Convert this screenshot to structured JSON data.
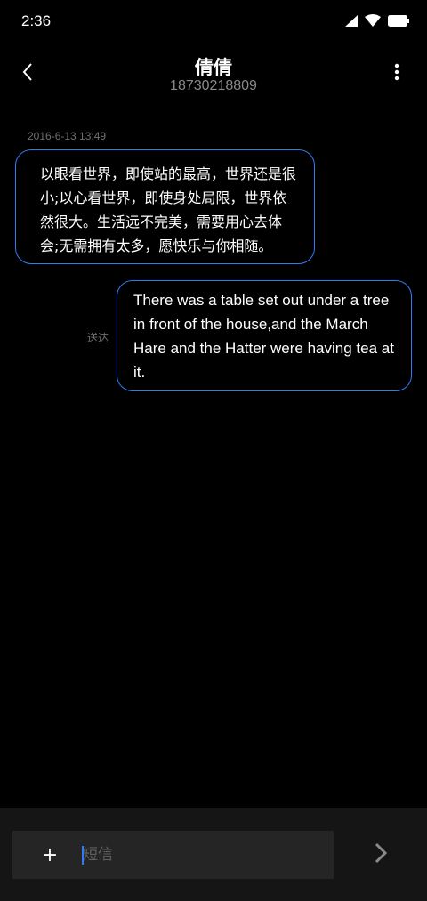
{
  "status_bar": {
    "time": "2:36",
    "icons": [
      "signal-icon",
      "wifi-icon",
      "battery-icon"
    ]
  },
  "header": {
    "contact_name": "倩倩",
    "contact_number": "18730218809",
    "back_icon": "chevron-left-icon",
    "more_icon": "more-vertical-icon"
  },
  "messages": {
    "timestamp": "2016-6-13 13:49",
    "received_text": "以眼看世界，即使站的最高，世界还是很小;以心看世界，即使身处局限，世界依然很大。生活远不完美，需要用心去体会;无需拥有太多，愿快乐与你相随。",
    "sent_text": "There was a table set out under a tree in front of the house,and the March Hare and the Hatter were having tea at it.",
    "sent_status": "送达"
  },
  "compose": {
    "add_label": "+",
    "placeholder": "短信",
    "value": "",
    "send_icon": "chevron-right-icon"
  },
  "colors": {
    "background": "#000000",
    "bubble_border": "#2f7df6",
    "secondary_text": "#8a8a8a",
    "compose_bar": "#151515",
    "compose_field": "#252525"
  }
}
